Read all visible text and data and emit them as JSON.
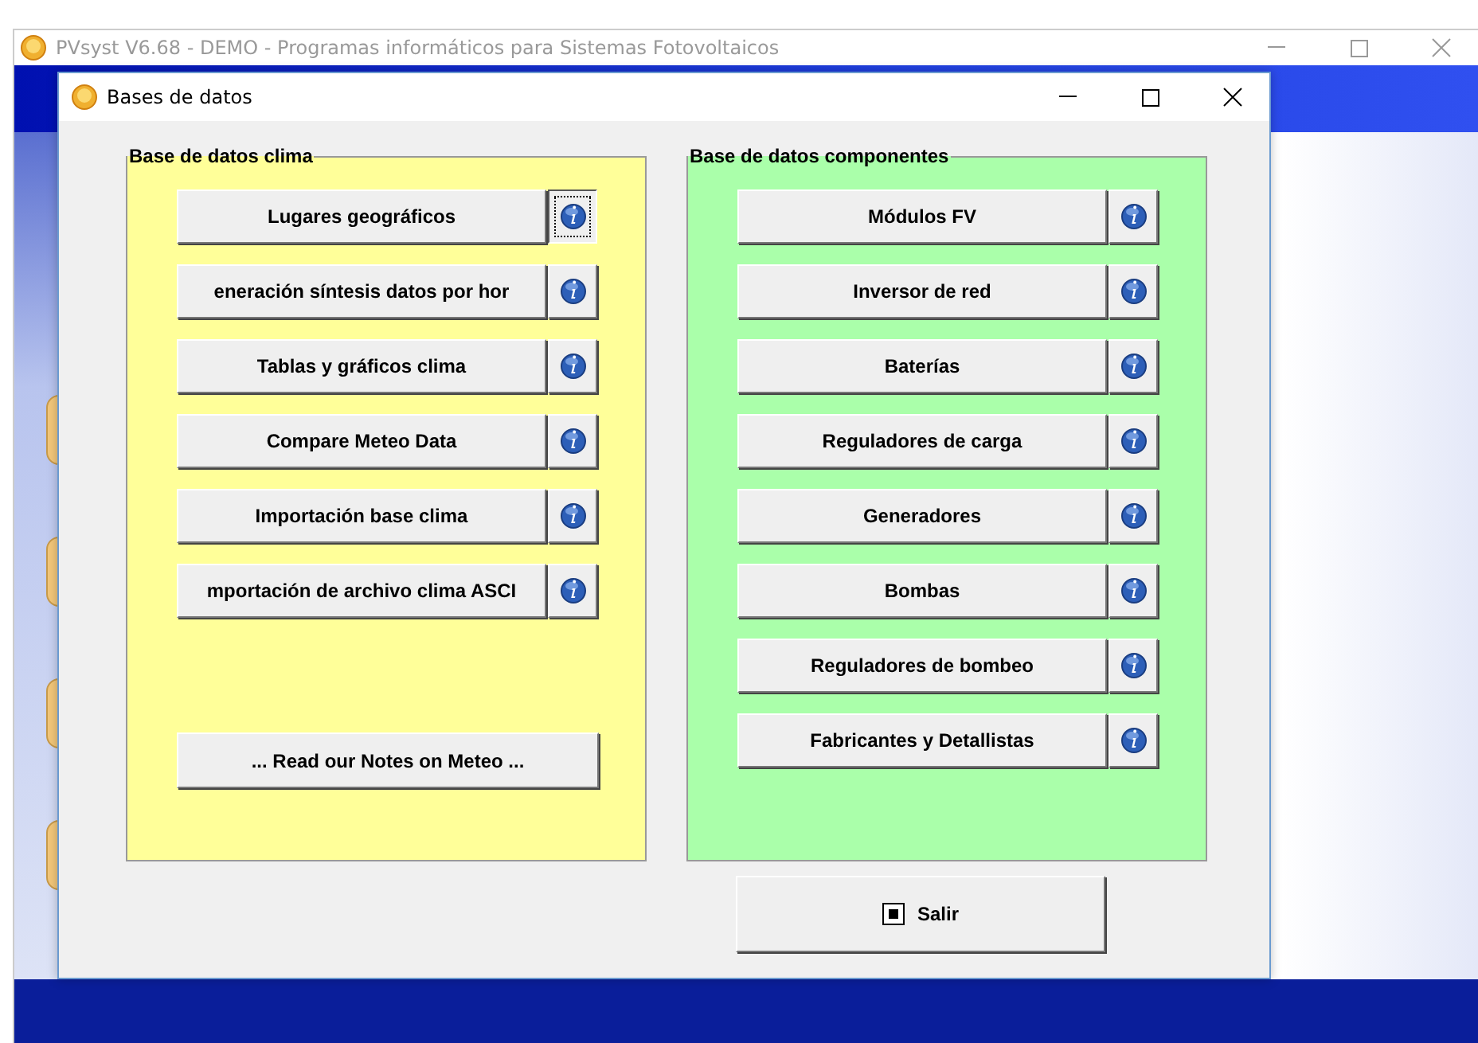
{
  "app_window": {
    "title": "PVsyst V6.68 - DEMO - Programas informáticos para Sistemas Fotovoltaicos"
  },
  "dialog": {
    "title": "Bases de datos"
  },
  "groups": [
    {
      "title": "Base de datos clima",
      "color": "#ffff99",
      "buttons": [
        {
          "label": "Lugares geográficos",
          "focused": true
        },
        {
          "label": "eneración síntesis datos por hor",
          "focused": false
        },
        {
          "label": "Tablas y gráficos clima",
          "focused": false
        },
        {
          "label": "Compare Meteo Data",
          "focused": false
        },
        {
          "label": "Importación base clima",
          "focused": false
        },
        {
          "label": "mportación de archivo clima ASCI",
          "focused": false
        }
      ],
      "extra_button": {
        "label": "... Read our Notes on Meteo ..."
      }
    },
    {
      "title": "Base de datos componentes",
      "color": "#aaffaa",
      "buttons": [
        {
          "label": "Módulos FV",
          "focused": false
        },
        {
          "label": "Inversor de red",
          "focused": false
        },
        {
          "label": "Baterías",
          "focused": false
        },
        {
          "label": "Reguladores de carga",
          "focused": false
        },
        {
          "label": "Generadores",
          "focused": false
        },
        {
          "label": "Bombas",
          "focused": false
        },
        {
          "label": "Reguladores de bombeo",
          "focused": false
        },
        {
          "label": "Fabricantes y Detallistas",
          "focused": false
        }
      ]
    }
  ],
  "exit_button": {
    "label": "Salir"
  }
}
